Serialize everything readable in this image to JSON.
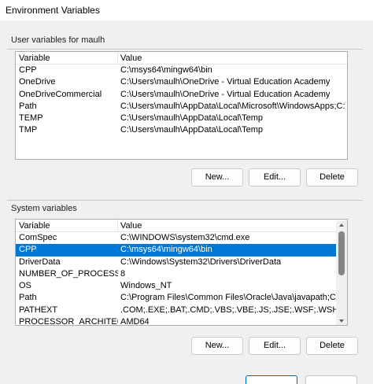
{
  "window": {
    "title": "Environment Variables"
  },
  "user_section": {
    "label": "User variables for maulh",
    "columns": [
      "Variable",
      "Value"
    ],
    "rows": [
      {
        "variable": "CPP",
        "value": "C:\\msys64\\mingw64\\bin"
      },
      {
        "variable": "OneDrive",
        "value": "C:\\Users\\maulh\\OneDrive - Virtual Education Academy"
      },
      {
        "variable": "OneDriveCommercial",
        "value": "C:\\Users\\maulh\\OneDrive - Virtual Education Academy"
      },
      {
        "variable": "Path",
        "value": "C:\\Users\\maulh\\AppData\\Local\\Microsoft\\WindowsApps;C:\\Use..."
      },
      {
        "variable": "TEMP",
        "value": "C:\\Users\\maulh\\AppData\\Local\\Temp"
      },
      {
        "variable": "TMP",
        "value": "C:\\Users\\maulh\\AppData\\Local\\Temp"
      }
    ],
    "buttons": {
      "new": "New...",
      "edit": "Edit...",
      "delete": "Delete"
    }
  },
  "system_section": {
    "label": "System variables",
    "columns": [
      "Variable",
      "Value"
    ],
    "selected_index": 1,
    "rows": [
      {
        "variable": "ComSpec",
        "value": "C:\\WINDOWS\\system32\\cmd.exe"
      },
      {
        "variable": "CPP",
        "value": "C:\\msys64\\mingw64\\bin"
      },
      {
        "variable": "DriverData",
        "value": "C:\\Windows\\System32\\Drivers\\DriverData"
      },
      {
        "variable": "NUMBER_OF_PROCESSORS",
        "value": "8"
      },
      {
        "variable": "OS",
        "value": "Windows_NT"
      },
      {
        "variable": "Path",
        "value": "C:\\Program Files\\Common Files\\Oracle\\Java\\javapath;C:\\Windo..."
      },
      {
        "variable": "PATHEXT",
        "value": ".COM;.EXE;.BAT;.CMD;.VBS;.VBE;.JS;.JSE;.WSF;.WSH;.MSC"
      },
      {
        "variable": "PROCESSOR_ARCHITECTURE",
        "value": "AMD64"
      }
    ],
    "buttons": {
      "new": "New...",
      "edit": "Edit...",
      "delete": "Delete"
    }
  },
  "colors": {
    "selection": "#0078d7",
    "dialog_bg": "#f0f0f0",
    "primary_border": "#0067c0"
  }
}
